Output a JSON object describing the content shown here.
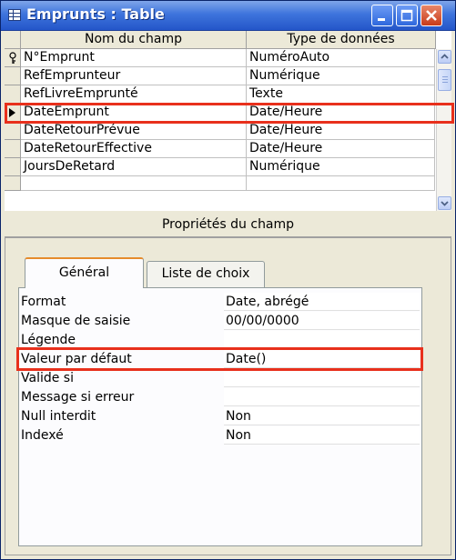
{
  "window": {
    "title": "Emprunts : Table",
    "icon": "table-icon",
    "controls": [
      "minimize-icon",
      "maximize-icon",
      "close-icon"
    ]
  },
  "grid": {
    "headers": {
      "name": "Nom du champ",
      "type": "Type de données"
    },
    "rows": [
      {
        "name": "N°Emprunt",
        "type": "NuméroAuto",
        "selector": "key-icon"
      },
      {
        "name": "RefEmprunteur",
        "type": "Numérique",
        "selector": ""
      },
      {
        "name": "RefLivreEmprunté",
        "type": "Texte",
        "selector": ""
      },
      {
        "name": "DateEmprunt",
        "type": "Date/Heure",
        "selector": "current-row-arrow-icon"
      },
      {
        "name": "DateRetourPrévue",
        "type": "Date/Heure",
        "selector": ""
      },
      {
        "name": "DateRetourEffective",
        "type": "Date/Heure",
        "selector": ""
      },
      {
        "name": "JoursDeRetard",
        "type": "Numérique",
        "selector": ""
      }
    ]
  },
  "properties": {
    "title": "Propriétés du champ",
    "tabs": [
      "Général",
      "Liste de choix"
    ],
    "active_tab": "Général",
    "rows": [
      {
        "label": "Format",
        "value": "Date, abrégé"
      },
      {
        "label": "Masque de saisie",
        "value": "00/00/0000"
      },
      {
        "label": "Légende",
        "value": ""
      },
      {
        "label": "Valeur par défaut",
        "value": "Date()"
      },
      {
        "label": "Valide si",
        "value": ""
      },
      {
        "label": "Message si erreur",
        "value": ""
      },
      {
        "label": "Null interdit",
        "value": "Non"
      },
      {
        "label": "Indexé",
        "value": "Non"
      }
    ]
  },
  "colors": {
    "highlight": "#e8301c",
    "titlebar": "#2f62d6",
    "tab_accent": "#e68b2c"
  }
}
